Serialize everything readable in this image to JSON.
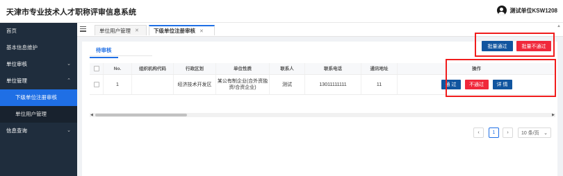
{
  "header": {
    "title": "天津市专业技术人才职称评审信息系统",
    "user": "测试单位KSW1208"
  },
  "sidebar": {
    "items": [
      {
        "label": "首页"
      },
      {
        "label": "基本信息维护"
      },
      {
        "label": "单位审核",
        "chevron": "⌄"
      },
      {
        "label": "单位管理",
        "chevron": "⌃"
      },
      {
        "label": "下级单位注册审核"
      },
      {
        "label": "单位用户管理"
      },
      {
        "label": "信息查询",
        "chevron": "⌄"
      }
    ]
  },
  "tabs": [
    {
      "label": "单位用户管理",
      "close": "✕"
    },
    {
      "label": "下级单位注册审核",
      "close": "✕"
    }
  ],
  "subtab": "待审核",
  "bulk": {
    "pass": "批量通过",
    "fail": "批量不通过"
  },
  "table": {
    "headers": [
      "No.",
      "组织机构代码",
      "行政区划",
      "单位性质",
      "联系人",
      "联系电话",
      "通讯地址",
      "操作"
    ],
    "rows": [
      {
        "no": "1",
        "org_code": "",
        "region": "经济技术开发区",
        "nature": "某公有制企业(合外资独资/合资企业)",
        "contact": "测试",
        "phone": "13011111111",
        "address": "11",
        "pass": "通 过",
        "fail": "不通过",
        "detail": "详 情"
      }
    ]
  },
  "pagination": {
    "prev": "‹",
    "current": "1",
    "next": "›",
    "size": "10 条/页",
    "size_chevron": "⌄"
  },
  "icons": {
    "close": "close-icon",
    "menu": "menu-icon",
    "chevron": "chevron-down-icon"
  },
  "colors": {
    "sidebar": "#1f2d3d",
    "active": "#1f6fe5",
    "primary": "#11559f",
    "danger": "#f0283b"
  }
}
